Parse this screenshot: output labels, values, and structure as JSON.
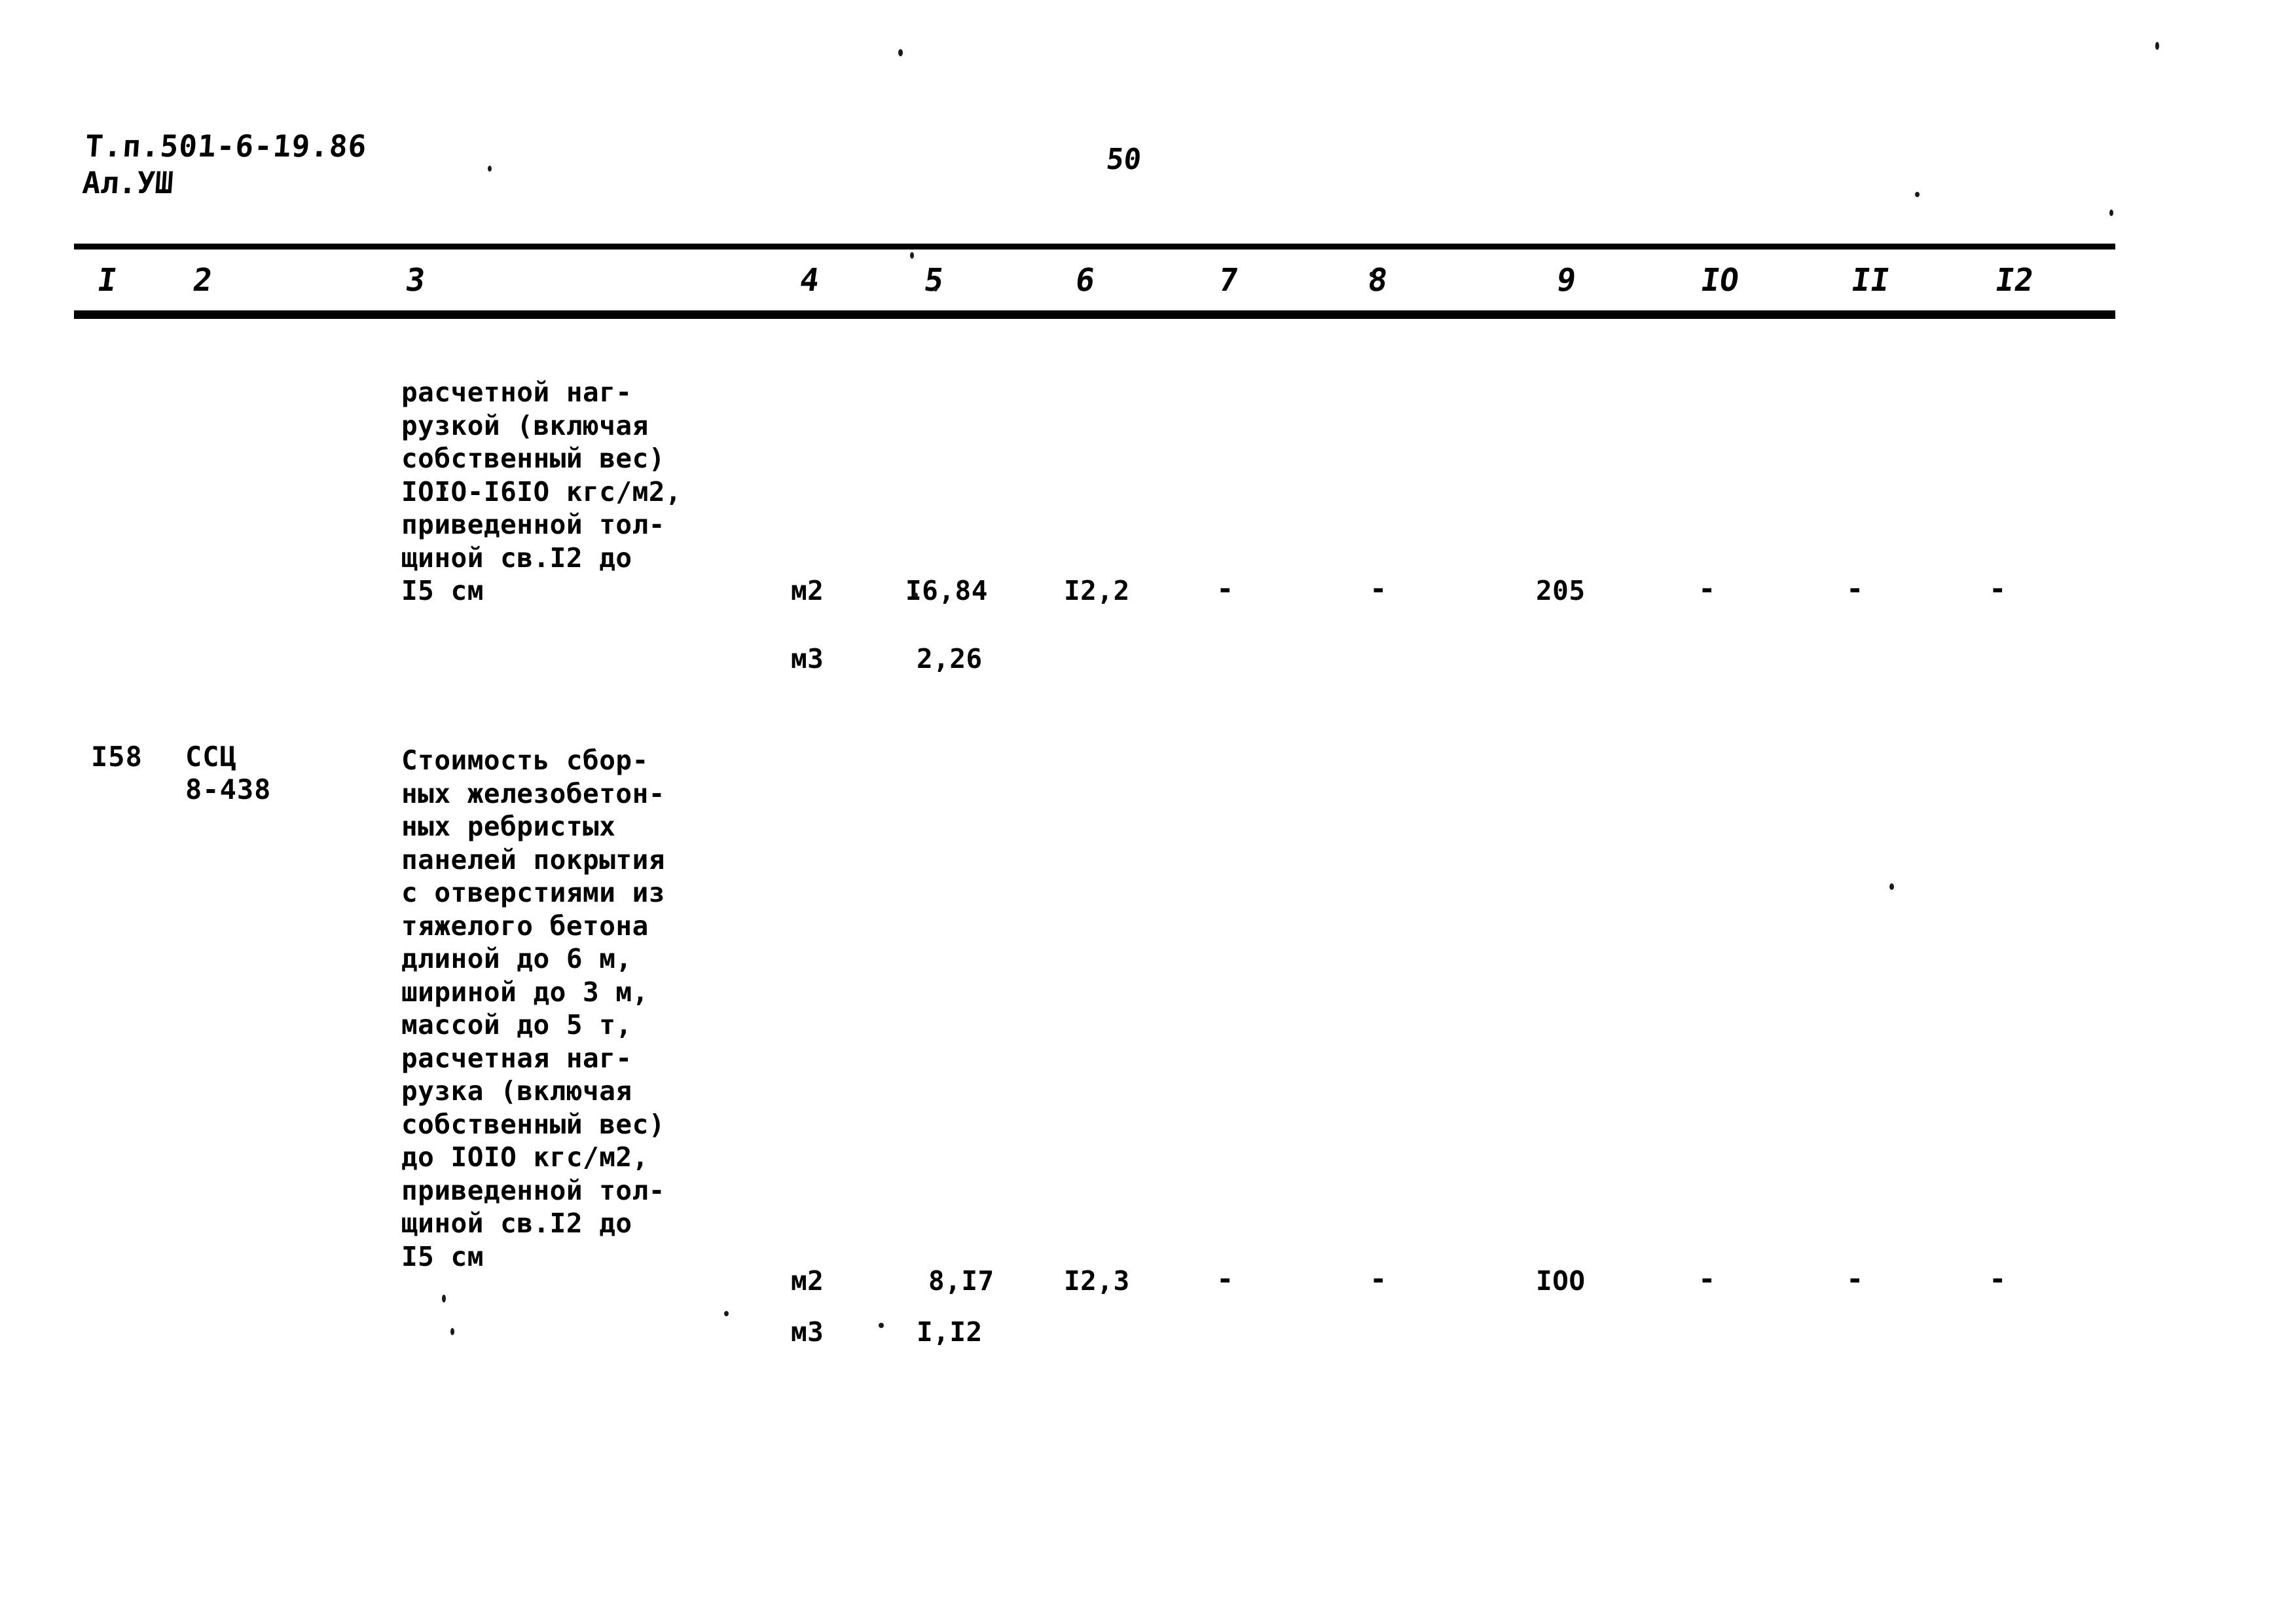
{
  "document": {
    "header_line1": "Т.п.501-6-19.86",
    "header_line2": "Ал.УШ",
    "page_number": "50"
  },
  "table": {
    "column_headers": [
      "I",
      "2",
      "3",
      "4",
      "5",
      "6",
      "7",
      "8",
      "9",
      "IO",
      "II",
      "I2"
    ],
    "rows": [
      {
        "id": "",
        "code": "",
        "description": "расчетной наг-\nрузкой (включая\nсобственный вес)\nIOIO-I6IO кгс/м2,\nприведенной тол-\nщиной св.I2 до\nI5 см",
        "measures": [
          {
            "unit": "м2",
            "c5": "I6,84",
            "c6": "I2,2",
            "c7": "-",
            "c8": "-",
            "c9": "205",
            "c10": "-",
            "c11": "-",
            "c12": "-"
          },
          {
            "unit": "м3",
            "c5": "2,26",
            "c6": "",
            "c7": "",
            "c8": "",
            "c9": "",
            "c10": "",
            "c11": "",
            "c12": ""
          }
        ]
      },
      {
        "id": "I58",
        "code": "ССЦ\n8-438",
        "description": "Стоимость сбор-\nных железобетон-\nных ребристых\nпанелей покрытия\nс отверстиями из\nтяжелого бетона\nдлиной до 6 м,\nшириной до 3 м,\nмассой до 5 т,\nрасчетная наг-\nрузка (включая\nсобственный вес)\nдо IOIO кгс/м2,\nприведенной тол-\nщиной св.I2 до\nI5 см",
        "measures": [
          {
            "unit": "м2",
            "c5": "8,I7",
            "c6": "I2,3",
            "c7": "-",
            "c8": "-",
            "c9": "IOO",
            "c10": "-",
            "c11": "-",
            "c12": "-"
          },
          {
            "unit": "м3",
            "c5": "I,I2",
            "c6": "",
            "c7": "",
            "c8": "",
            "c9": "",
            "c10": "",
            "c11": "",
            "c12": ""
          }
        ]
      }
    ]
  }
}
